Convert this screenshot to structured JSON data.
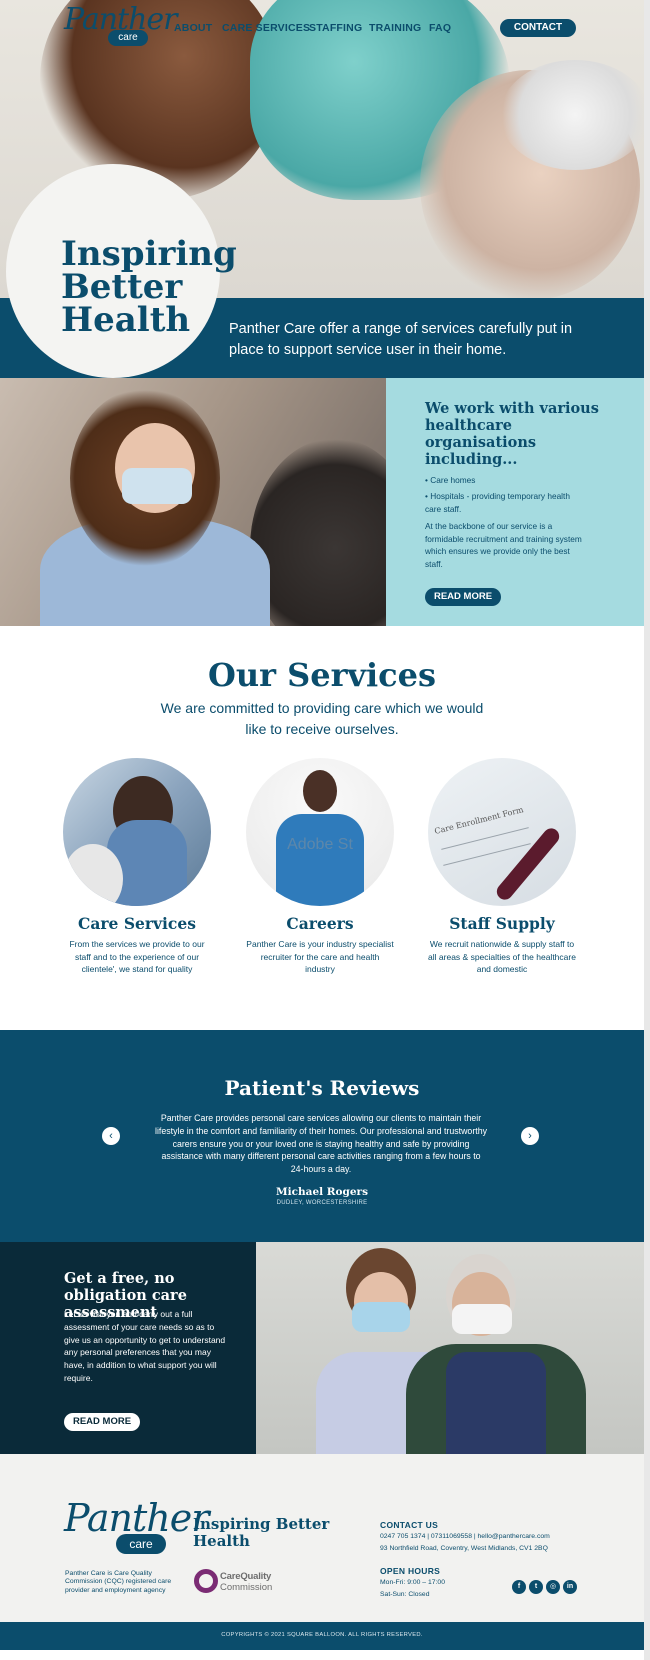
{
  "header": {
    "logo_word": "Panther",
    "logo_pill": "care",
    "nav": [
      "ABOUT",
      "CARE SERVICES",
      "STAFFING",
      "TRAINING",
      "FAQ"
    ],
    "contact_label": "CONTACT"
  },
  "hero": {
    "title_line1": "Inspiring",
    "title_line2": "Better",
    "title_line3": "Health",
    "tagline": "Panther Care offer a range of services carefully put in place to support service user in their home."
  },
  "work": {
    "title": "We work with various healthcare organisations including...",
    "item1": "• Care homes",
    "item2": "• Hospitals - providing temporary health care staff.",
    "paragraph": "At the backbone of our service is a formidable recruitment and training system which ensures we provide only the best staff.",
    "read_more": "READ MORE"
  },
  "services": {
    "title": "Our Services",
    "subtitle": "We are committed to providing care which we would like to receive ourselves.",
    "items": [
      {
        "title": "Care Services",
        "text": "From the services we provide to our staff and to the experience of our clientele', we stand for quality"
      },
      {
        "title": "Careers",
        "text": "Panther Care is your industry specialist recruiter for the care and health industry"
      },
      {
        "title": "Staff Supply",
        "text": "We recruit nationwide & supply staff to all areas & specialties of the healthcare and domestic"
      }
    ],
    "watermark": "Adobe St",
    "form_label": "Care Enrollment Form"
  },
  "reviews": {
    "title": "Patient's Reviews",
    "text": "Panther Care provides personal care services allowing our clients to maintain their lifestyle in the comfort and familiarity of their homes. Our professional and trustworthy carers ensure you or your loved one is staying healthy and safe by providing assistance with many different personal care activities ranging from a few hours to 24-hours a day.",
    "name": "Michael Rogers",
    "location": "DUDLEY, WORCESTERSHIRE",
    "prev_icon": "chevron-left-icon",
    "next_icon": "chevron-right-icon"
  },
  "assessment": {
    "title": "Get a free, no obligation care assessment",
    "text": "Let us visit you and carry out a full assessment of your care needs so as to give us an opportunity to get to understand any personal preferences that you may have, in addition to what support you will require.",
    "read_more": "READ MORE"
  },
  "footer": {
    "logo_word": "Panther",
    "logo_pill": "care",
    "tagline": "Inspiring Better Health",
    "cqc_text": "Panther Care is Care Quality Commission (CQC) registered care provider and employment agency",
    "cqc_logo_line1": "CareQuality",
    "cqc_logo_line2": "Commission",
    "contact_title": "CONTACT US",
    "contact_line1": "0247 705 1374  |  07311069558  |  hello@panthercare.com",
    "contact_line2": "93 Northfield Road, Coventry, West Midlands, CV1 2BQ",
    "hours_title": "OPEN HOURS",
    "hours_line1": "Mon-Fri: 9:00 – 17:00",
    "hours_line2": "Sat-Sun: Closed",
    "social": [
      "f",
      "t",
      "◎",
      "in"
    ],
    "copyright": "COPYRIGHTS © 2021 SQUARE BALLOON. ALL RIGHTS RESERVED."
  },
  "colors": {
    "brand_navy": "#0b4d6c",
    "dark_navy": "#0a2a39",
    "light_teal": "#a5dbe0"
  }
}
